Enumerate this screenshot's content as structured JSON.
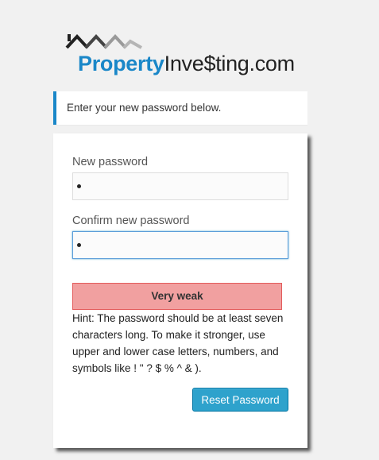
{
  "logo": {
    "word1": "Property",
    "word2": "Inve$ting.com",
    "colors": {
      "primary": "#1a87c8",
      "dark": "#222222",
      "roof_gray": "#b5b5b5"
    }
  },
  "message": {
    "text": "Enter your new password below.",
    "accent": "#1a87c8"
  },
  "form": {
    "new_password_label": "New password",
    "confirm_password_label": "Confirm new password",
    "new_password_value": "•",
    "confirm_password_value": "•",
    "strength": {
      "text": "Very weak",
      "color": "#f1a0a0"
    },
    "hint": "Hint: The password should be at least seven characters long. To make it stronger, use upper and lower case letters, numbers, and symbols like ! \" ? $ % ^ & ).",
    "submit_label": "Reset Password",
    "button_color": "#2ea2cc"
  }
}
